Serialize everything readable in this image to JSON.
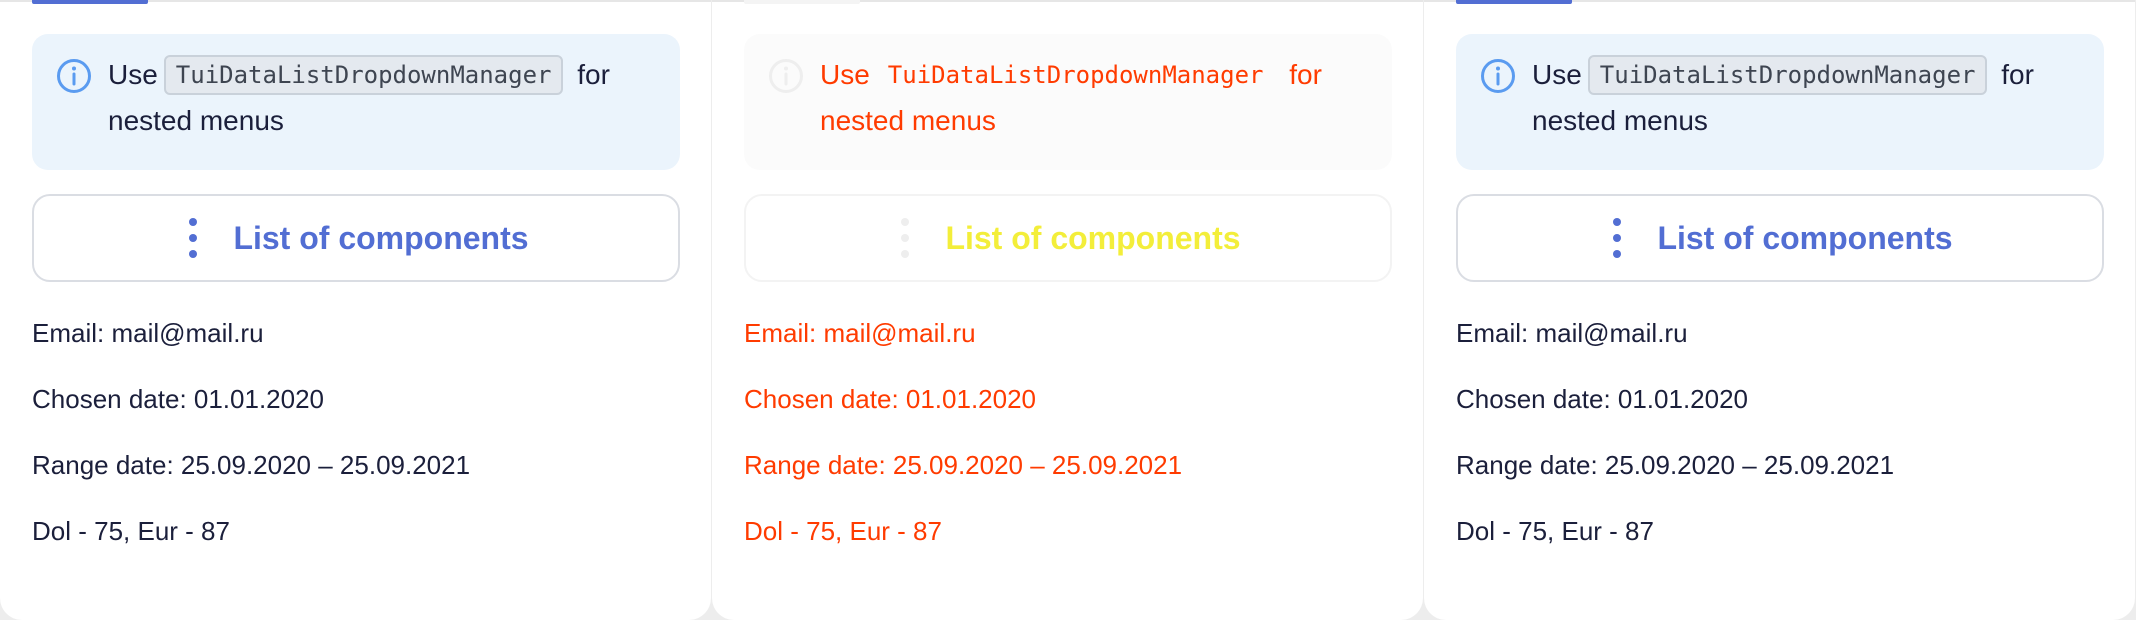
{
  "panels": [
    {
      "notice": {
        "icon": "info-icon",
        "text_before": "Use",
        "code": "TuiDataListDropdownManager",
        "text_after": "for nested menus"
      },
      "list_button": {
        "icon": "more-vertical-icon",
        "label": "List of components"
      },
      "info": {
        "email": "Email: mail@mail.ru",
        "chosen_date": "Chosen date: 01.01.2020",
        "range_date": "Range date: 25.09.2020 – 25.09.2021",
        "rates": "Dol - 75, Eur - 87"
      }
    },
    {
      "notice": {
        "icon": "info-icon",
        "text_before": "Use",
        "code": "TuiDataListDropdownManager",
        "text_after": "for nested menus"
      },
      "list_button": {
        "icon": "more-vertical-icon",
        "label": "List of components"
      },
      "info": {
        "email": "Email: mail@mail.ru",
        "chosen_date": "Chosen date: 01.01.2020",
        "range_date": "Range date: 25.09.2020 – 25.09.2021",
        "rates": "Dol - 75, Eur - 87"
      }
    },
    {
      "notice": {
        "icon": "info-icon",
        "text_before": "Use",
        "code": "TuiDataListDropdownManager",
        "text_after": "for nested menus"
      },
      "list_button": {
        "icon": "more-vertical-icon",
        "label": "List of components"
      },
      "info": {
        "email": "Email: mail@mail.ru",
        "chosen_date": "Chosen date: 01.01.2020",
        "range_date": "Range date: 25.09.2020 – 25.09.2021",
        "rates": "Dol - 75, Eur - 87"
      }
    }
  ],
  "colors": {
    "accent": "#526ed3",
    "notice_bg": "#ebf4fc",
    "text": "#1b1f3b",
    "faded_text": "#ff3b00",
    "faded_label": "#f3ee3a"
  }
}
